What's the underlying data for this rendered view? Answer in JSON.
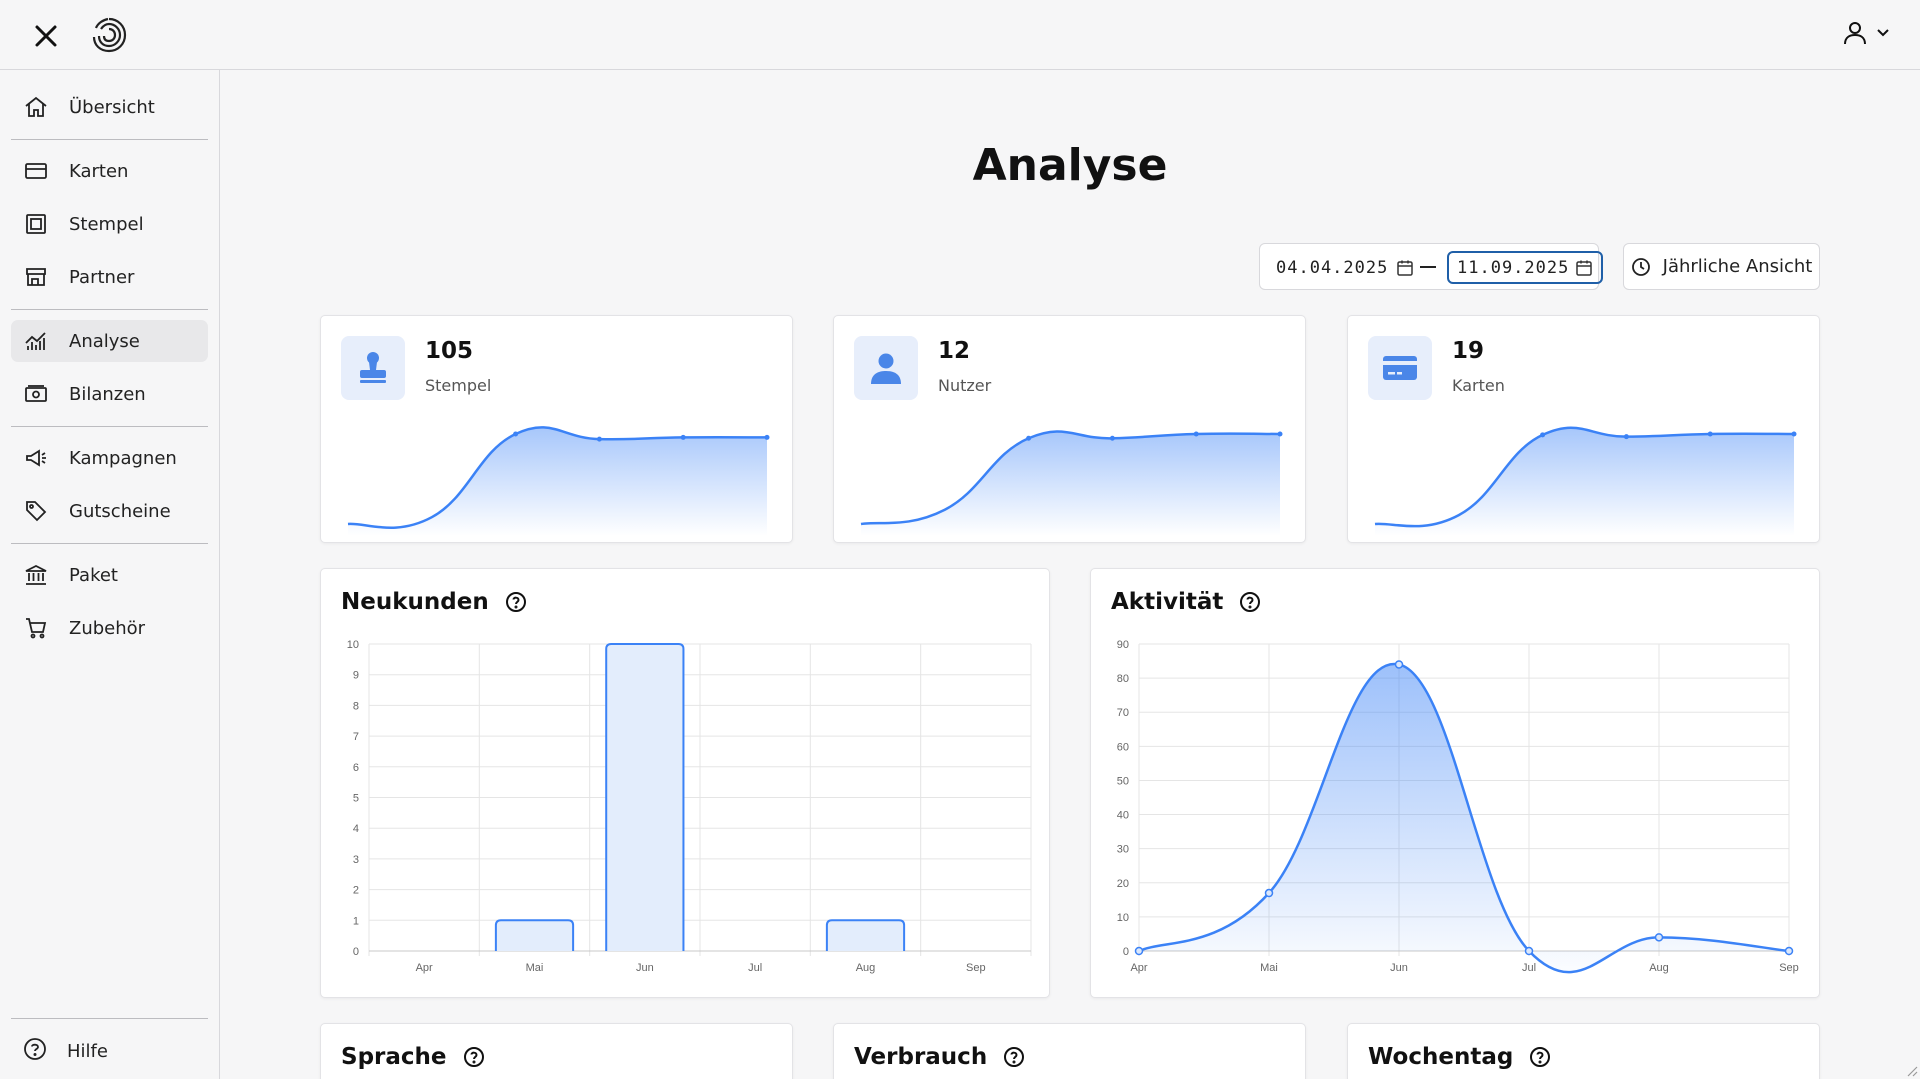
{
  "header": {
    "close_icon": "close-icon",
    "logo_icon": "spiral-logo-icon",
    "user_icon": "user-icon",
    "user_menu_icon": "chevron-down-icon"
  },
  "sidebar": {
    "items": [
      {
        "label": "Übersicht",
        "icon": "home-icon"
      },
      {
        "label": "Karten",
        "icon": "card-icon"
      },
      {
        "label": "Stempel",
        "icon": "stamp-icon"
      },
      {
        "label": "Partner",
        "icon": "store-icon"
      },
      {
        "label": "Analyse",
        "icon": "analytics-icon",
        "active": true
      },
      {
        "label": "Bilanzen",
        "icon": "money-icon"
      },
      {
        "label": "Kampagnen",
        "icon": "megaphone-icon"
      },
      {
        "label": "Gutscheine",
        "icon": "tag-icon"
      },
      {
        "label": "Paket",
        "icon": "bank-icon"
      },
      {
        "label": "Zubehör",
        "icon": "cart-icon"
      }
    ],
    "help_label": "Hilfe"
  },
  "page": {
    "title": "Analyse",
    "date_start": "04.04.2025",
    "date_end": "11.09.2025",
    "yearly_button": "Jährliche Ansicht"
  },
  "stats": [
    {
      "value": "105",
      "label": "Stempel",
      "icon": "stamp-icon",
      "spark": [
        0,
        4,
        53,
        50,
        51,
        51
      ]
    },
    {
      "value": "12",
      "label": "Nutzer",
      "icon": "user-icon",
      "spark": [
        0,
        1,
        6,
        6,
        6.3,
        6.3
      ]
    },
    {
      "value": "19",
      "label": "Karten",
      "icon": "card-icon",
      "spark": [
        0,
        1,
        10,
        9.8,
        10.1,
        10.1
      ]
    }
  ],
  "charts": {
    "neukunden_title": "Neukunden",
    "aktivitaet_title": "Aktivität"
  },
  "bottom_cards": {
    "sprache": "Sprache",
    "verbrauch": "Verbrauch",
    "wochentag": "Wochentag"
  },
  "colors": {
    "accent": "#3b82f6",
    "accent_fill": "#e3edfc",
    "icon_bg": "#e7eefb"
  },
  "chart_data": [
    {
      "type": "bar",
      "title": "Neukunden",
      "categories": [
        "Apr",
        "Mai",
        "Jun",
        "Jul",
        "Aug",
        "Sep"
      ],
      "values": [
        0,
        1,
        10,
        0,
        1,
        0
      ],
      "ylim": [
        0,
        10
      ],
      "yticks": [
        0,
        1,
        2,
        3,
        4,
        5,
        6,
        7,
        8,
        9,
        10
      ],
      "grid": true
    },
    {
      "type": "area",
      "title": "Aktivität",
      "categories": [
        "Apr",
        "Mai",
        "Jun",
        "Jul",
        "Aug",
        "Sep"
      ],
      "values": [
        0,
        17,
        84,
        0,
        4,
        0
      ],
      "ylim": [
        0,
        90
      ],
      "yticks": [
        0,
        10,
        20,
        30,
        40,
        50,
        60,
        70,
        80,
        90
      ],
      "grid": true
    }
  ]
}
